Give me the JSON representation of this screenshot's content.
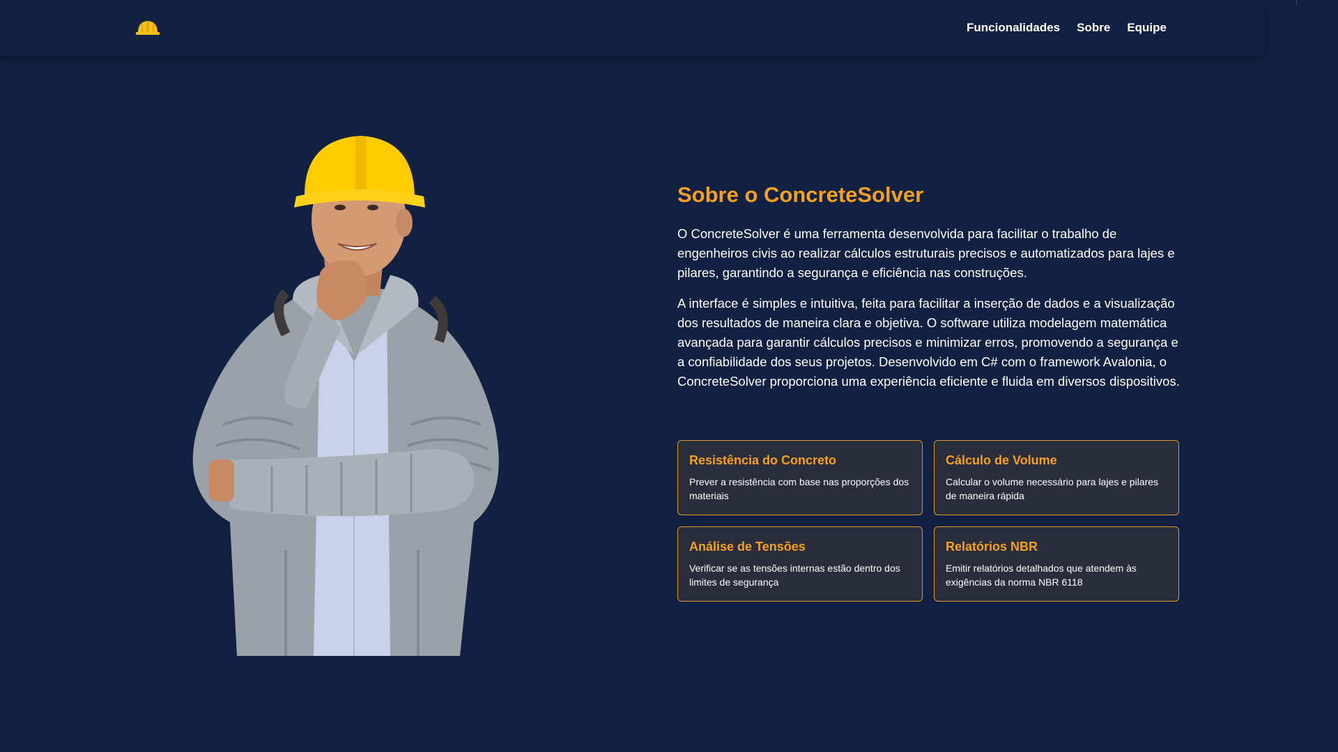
{
  "header": {
    "logo_icon": "hard-hat-icon",
    "nav": [
      {
        "label": "Funcionalidades"
      },
      {
        "label": "Sobre"
      },
      {
        "label": "Equipe"
      }
    ]
  },
  "hero": {
    "image": "construction-engineer-photo"
  },
  "about": {
    "title": "Sobre o ConcreteSolver",
    "paragraphs": [
      "O ConcreteSolver é uma ferramenta desenvolvida para facilitar o trabalho de engenheiros civis ao realizar cálculos estruturais precisos e automatizados para lajes e pilares, garantindo a segurança e eficiência nas construções.",
      "A interface é simples e intuitiva, feita para facilitar a inserção de dados e a visualização dos resultados de maneira clara e objetiva. O software utiliza modelagem matemática avançada para garantir cálculos precisos e minimizar erros, promovendo a segurança e a confiabilidade dos seus projetos. Desenvolvido em C# com o framework Avalonia, o ConcreteSolver proporciona uma experiência eficiente e fluida em diversos dispositivos."
    ]
  },
  "features": [
    {
      "title": "Resistência do Concreto",
      "description": "Prever a resistência com base nas proporções dos materiais"
    },
    {
      "title": "Cálculo de Volume",
      "description": "Calcular o volume necessário para lajes e pilares de maneira rápida"
    },
    {
      "title": "Análise de Tensões",
      "description": "Verificar se as tensões internas estão dentro dos limites de segurança"
    },
    {
      "title": "Relatórios NBR",
      "description": "Emitir relatórios detalhados que atendem às exigências da norma NBR 6118"
    }
  ],
  "colors": {
    "background": "#122142",
    "accent": "#f5a11b",
    "card_background": "#2a2d3c",
    "card_border": "#e09a2a"
  }
}
